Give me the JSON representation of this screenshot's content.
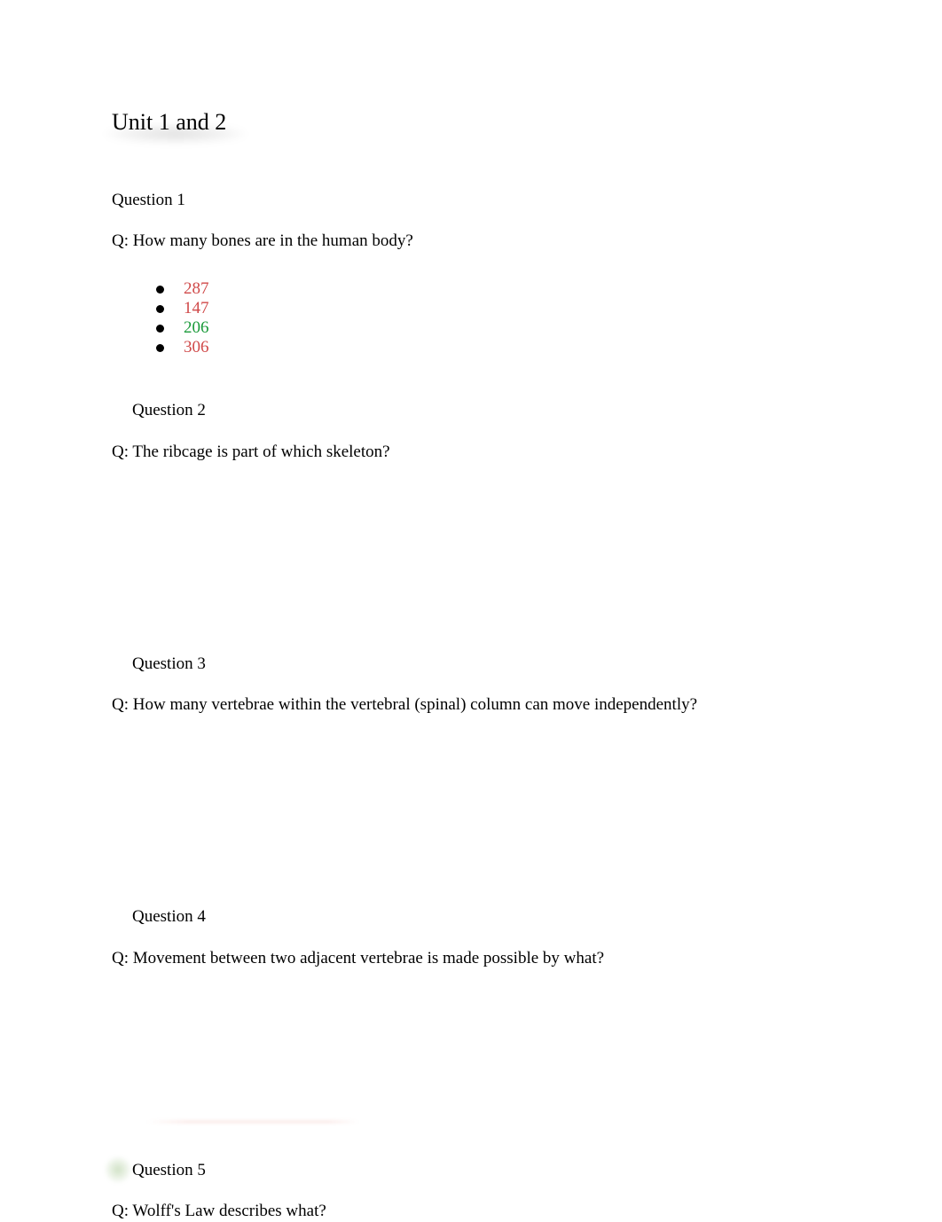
{
  "document": {
    "title": "Unit 1 and 2",
    "colors": {
      "incorrect": "#d04a4a",
      "correct": "#1a9a3a"
    },
    "questions": [
      {
        "heading": "Question 1",
        "text": "Q:  How many bones are in the human body?",
        "options": [
          {
            "label": "287",
            "status": "incorrect"
          },
          {
            "label": "147",
            "status": "incorrect"
          },
          {
            "label": "206",
            "status": "correct"
          },
          {
            "label": "306",
            "status": "incorrect"
          }
        ]
      },
      {
        "heading": "Question 2",
        "text": "Q: The ribcage is part of which skeleton?"
      },
      {
        "heading": "Question 3",
        "text": "Q:  How many vertebrae within the vertebral (spinal) column can move independently?"
      },
      {
        "heading": "Question 4",
        "text": "Q:  Movement between two adjacent vertebrae is made possible by what?"
      },
      {
        "heading": "Question 5",
        "text": "Q:  Wolff's Law describes what?"
      }
    ]
  }
}
